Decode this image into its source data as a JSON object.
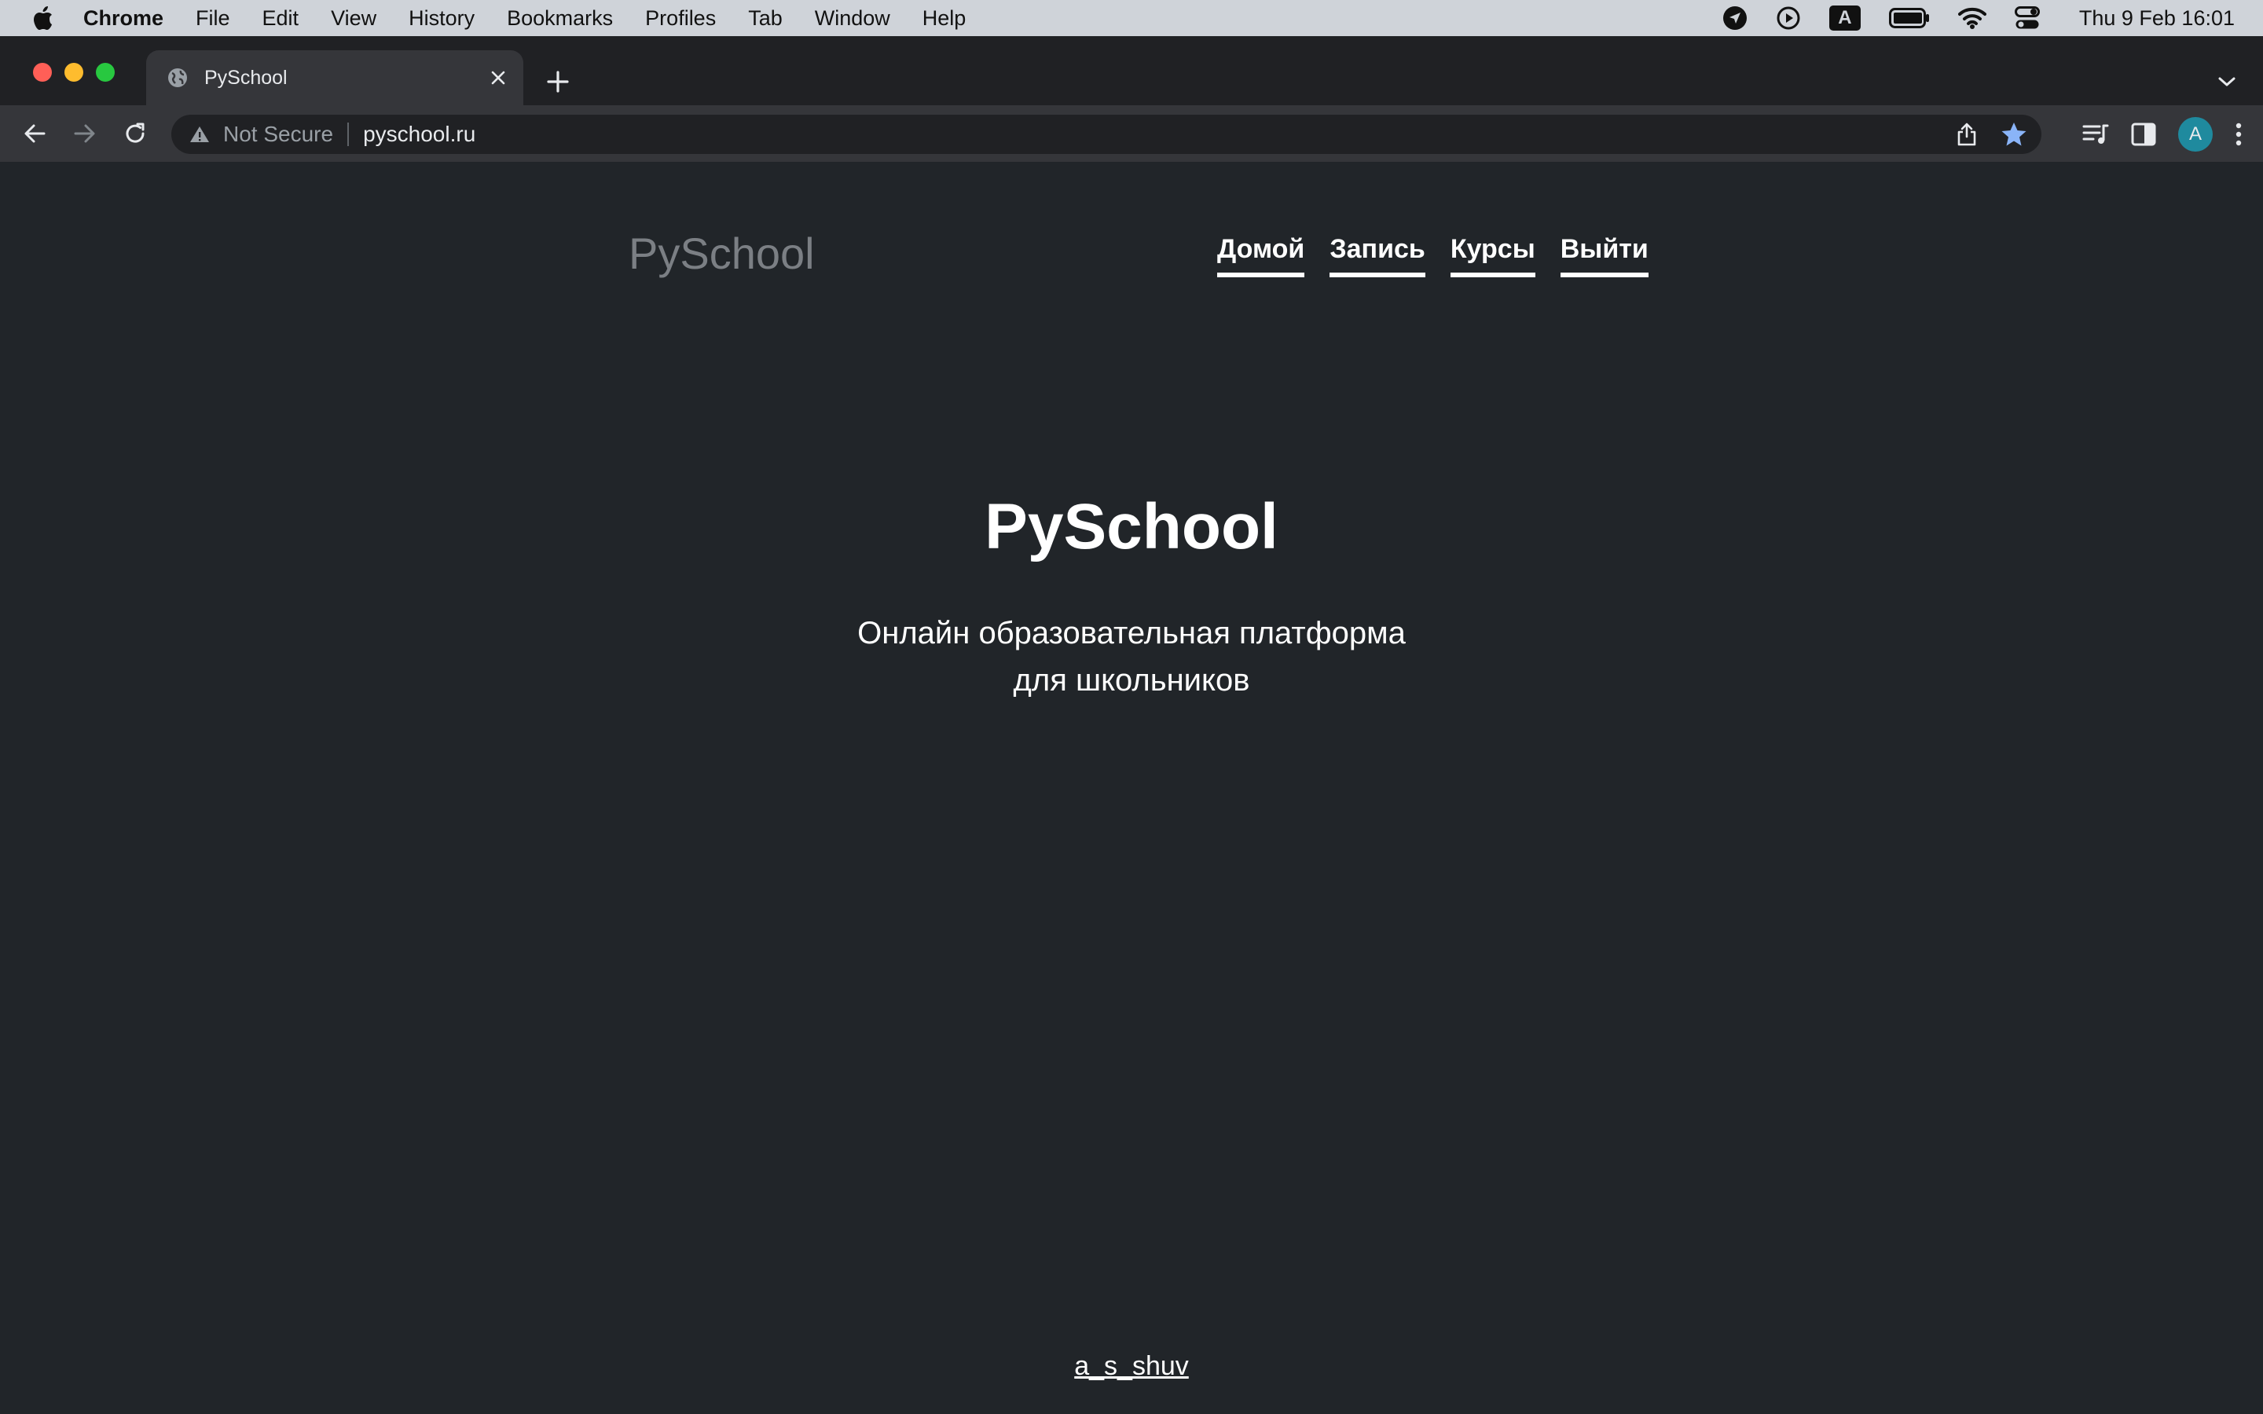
{
  "menubar": {
    "app": "Chrome",
    "items": [
      "File",
      "Edit",
      "View",
      "History",
      "Bookmarks",
      "Profiles",
      "Tab",
      "Window",
      "Help"
    ],
    "status": {
      "input_source": "A",
      "datetime": "Thu 9 Feb  16:01"
    }
  },
  "browser": {
    "tab": {
      "title": "PySchool"
    },
    "omnibox": {
      "security": "Not Secure",
      "url": "pyschool.ru"
    },
    "profile_initial": "A",
    "colors": {
      "close": "#ff5f57",
      "minimize": "#febc2e",
      "zoom": "#28c840",
      "bookmark_star": "#8ab4f8",
      "avatar": "#1f8a9e"
    }
  },
  "page": {
    "logo": "PySchool",
    "nav": [
      "Домой",
      "Запись",
      "Курсы",
      "Выйти"
    ],
    "hero": {
      "title": "PySchool",
      "lead_line1": "Онлайн образовательная платформа",
      "lead_line2": "для школьников"
    },
    "footer_link": "a_s_shuv"
  }
}
